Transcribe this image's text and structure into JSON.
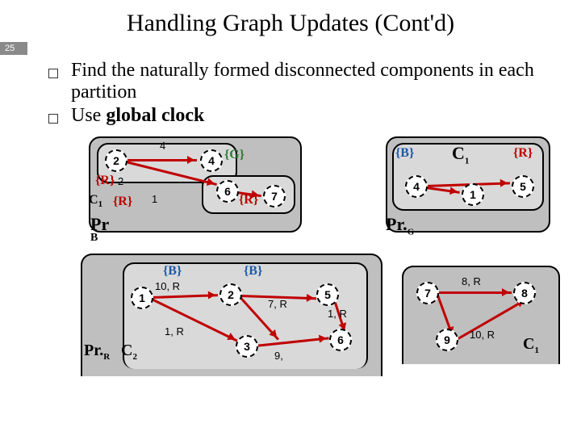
{
  "title": "Handling Graph Updates (Cont'd)",
  "page_number": "25",
  "bullets": [
    "Find the naturally formed disconnected components in each partition",
    "Use global clock"
  ],
  "labels": {
    "PrB": "Pr",
    "PrB_sub": "B",
    "PrG": "Pr.",
    "PrG_sub": "G",
    "PrR": "Pr.",
    "PrR_sub": "R",
    "C1a": "C",
    "C1a_sub": "1",
    "C1b": "C",
    "C1b_sub": "1",
    "C1c": "C",
    "C1c_sub": "1",
    "C2": "C",
    "C2_sub": "2",
    "tagR": "{R}",
    "tagG": "{G}",
    "tagB": "{B}"
  },
  "nodes": {
    "tn2": "2",
    "tn4": "4",
    "tn6": "6",
    "tn7": "7",
    "rn4": "4",
    "rn1": "1",
    "rn5": "5",
    "bn1": "1",
    "bn2": "2",
    "bn3": "3",
    "bn5": "5",
    "bn6": "6",
    "gn7": "7",
    "gn8": "8",
    "gn9": "9"
  },
  "edges": {
    "e4": "4",
    "e2": "2",
    "e1": "1",
    "e10R_a": "10, R",
    "e1R": "1, R",
    "e7R": "7, R",
    "e1Rb": "1, R",
    "e9": "9,",
    "e8R": "8, R",
    "e10R_b": "10, R"
  },
  "chart_data": {
    "type": "diagram",
    "description": "Partitioned graph showing three partitions Pr_B (blue), Pr_G (green), Pr_R (red) with components C1 and C2. Nodes are tagged with owning partition {R},{G},{B}. Red directed edges carry weight and owning partition labels.",
    "partitions": {
      "Pr_B": {
        "components": {
          "C1": [
            2,
            4,
            6,
            7
          ]
        }
      },
      "Pr_R": {
        "components": {
          "C2": [
            1,
            2,
            3,
            5,
            6
          ]
        }
      },
      "Pr_G": {
        "components": {
          "C1": [
            4,
            1,
            5,
            7,
            8,
            9
          ]
        }
      }
    },
    "node_tags": {
      "2": "{R}",
      "4": "{G}",
      "7": "{R}",
      "1": "{R}",
      "4r": "{B}",
      "5r": "{R}",
      "1b": "{B}",
      "2b": "{B}"
    },
    "edges": [
      {
        "from": 2,
        "to": 4,
        "w": 4
      },
      {
        "from": 4,
        "to": 6,
        "w": null
      },
      {
        "from": 6,
        "to": 7,
        "w": null
      },
      {
        "from": 1,
        "to": 4,
        "w": 2
      },
      {
        "from": 1,
        "to": 2,
        "w": 1
      },
      {
        "from": 4,
        "to": 1,
        "w": null
      },
      {
        "from": 4,
        "to": 5,
        "w": null
      },
      {
        "from": 1,
        "to": 2,
        "w": "10,R"
      },
      {
        "from": 2,
        "to": 3,
        "w": "1,R"
      },
      {
        "from": 2,
        "to": 5,
        "w": "7,R"
      },
      {
        "from": 5,
        "to": 6,
        "w": "1,R"
      },
      {
        "from": 3,
        "to": 6,
        "w": "9"
      },
      {
        "from": 7,
        "to": 8,
        "w": "8,R"
      },
      {
        "from": 8,
        "to": 9,
        "w": "10,R"
      },
      {
        "from": 9,
        "to": 7,
        "w": null
      }
    ]
  }
}
